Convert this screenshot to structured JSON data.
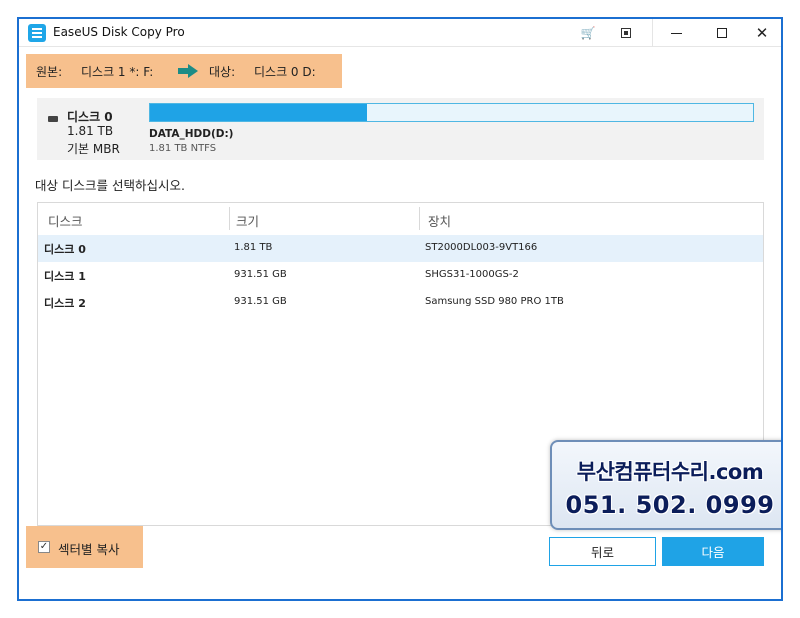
{
  "window": {
    "title": "EaseUS Disk Copy Pro"
  },
  "colors": {
    "accent": "#1fa3e6",
    "highlight": "#f7c08d",
    "arrow": "#1c8c86",
    "border": "#1b6fd1"
  },
  "path": {
    "source_label": "원본:",
    "source_value": "디스크 1 *: F:",
    "target_label": "대상:",
    "target_value": "디스크 0 D:"
  },
  "disk": {
    "name": "디스크 0",
    "size": "1.81 TB",
    "type": "기본 MBR",
    "partition_name": "DATA_HDD(D:)",
    "partition_info": "1.81 TB NTFS",
    "used_fraction": 0.36
  },
  "instruction": "대상 디스크를 선택하십시오.",
  "table": {
    "headers": [
      "디스크",
      "크기",
      "장치"
    ],
    "rows": [
      {
        "name": "디스크 0",
        "size": "1.81 TB",
        "device": "ST2000DL003-9VT166",
        "selected": true
      },
      {
        "name": "디스크 1",
        "size": "931.51 GB",
        "device": "SHGS31-1000GS-2",
        "selected": false
      },
      {
        "name": "디스크 2",
        "size": "931.51 GB",
        "device": "Samsung SSD 980 PRO 1TB",
        "selected": false
      }
    ]
  },
  "options": {
    "sector_copy_label": "섹터별 복사",
    "sector_copy_checked": true,
    "check_glyph": "✓"
  },
  "buttons": {
    "back": "뒤로",
    "next": "다음"
  },
  "watermark": {
    "line1": "부산컴퓨터수리.com",
    "line2": "051. 502. 0999"
  },
  "icons": {
    "cart": "cart-icon",
    "close": "✕"
  }
}
